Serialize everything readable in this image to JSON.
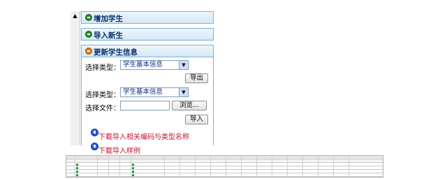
{
  "sections": {
    "add_student": "增加学生",
    "import_new": "导入新生",
    "update_info": "更新学生信息"
  },
  "export_form": {
    "type_label": "选择类型：",
    "type_value": "学生基本信息",
    "export_button": "导出"
  },
  "import_form": {
    "type_label": "选择类型：",
    "type_value": "学生基本信息",
    "file_label": "选择文件：",
    "file_value": "",
    "browse_button": "浏览...",
    "import_button": "导入"
  },
  "links": {
    "download_codes": "下载导入相关编码与类型名称",
    "download_sample": "下载导入样例"
  },
  "colors": {
    "header_border": "#7fb2d6",
    "link_red": "#c8102e",
    "section_title": "#0b2f6a"
  },
  "icons": {
    "collapsed": "green-circle-icon",
    "expanded": "orange-circle-icon",
    "download": "download-icon"
  }
}
